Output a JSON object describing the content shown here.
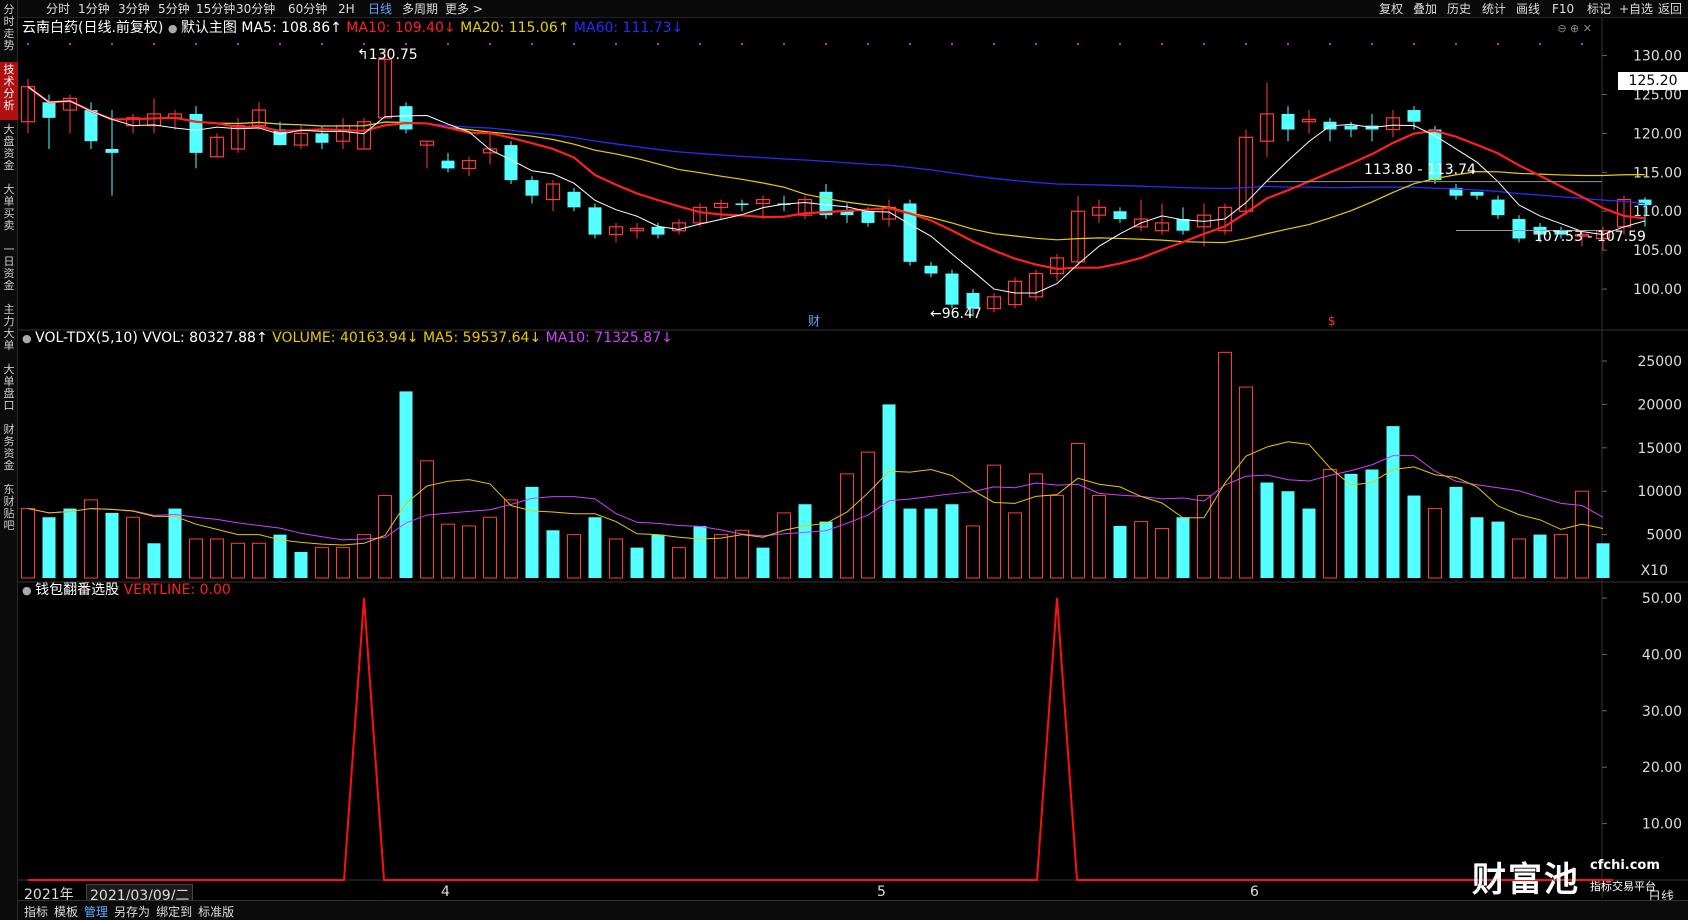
{
  "left_nav": [
    "分时走势",
    "技术分析",
    "大盘资金",
    "大单买卖",
    "一日资金",
    "主力大单",
    "大单盘口",
    "财务资金",
    "东财贴吧"
  ],
  "left_nav_active": 1,
  "period_tabs": [
    "分时",
    "1分钟",
    "3分钟",
    "5分钟",
    "15分钟",
    "30分钟",
    "60分钟",
    "2H",
    "日线",
    "多周期",
    "更多 >"
  ],
  "period_active": "日线",
  "right_tools": [
    "复权",
    "叠加",
    "历史",
    "统计",
    "画线",
    "F10",
    "标记",
    "+自选",
    "返回"
  ],
  "main_header": {
    "title": "云南白药(日线.前复权)",
    "template": "默认主图",
    "ma5": "MA5: 108.86↑",
    "ma10": "MA10: 109.40↓",
    "ma20": "MA20: 115.06↑",
    "ma60": "MA60: 111.73↓"
  },
  "vol_header": {
    "name": "VOL-TDX(5,10)",
    "vvol": "VVOL: 80327.88↑",
    "volume": "VOLUME: 40163.94↓",
    "ma5": "MA5: 59537.64↓",
    "ma10": "MA10: 71325.87↓"
  },
  "ind_header": {
    "name": "钱包翻番选股",
    "vertline": "VERTLINE: 0.00"
  },
  "annotations": {
    "high": "130.75",
    "low": "96.47",
    "range1": "113.80 - 113.74",
    "range2": "107.53 - 107.59",
    "price_tag": "125.20",
    "fin_mark": "财",
    "dollar_mark": "$"
  },
  "price_axis": [
    "130.00",
    "125.00",
    "120.00",
    "115.00",
    "110.00",
    "105.00",
    "100.00"
  ],
  "vol_axis": [
    "25000",
    "20000",
    "15000",
    "10000",
    "5000"
  ],
  "vol_unit": "X10",
  "ind_axis": [
    "50.00",
    "40.00",
    "30.00",
    "20.00",
    "10.00"
  ],
  "x_axis": {
    "year": "2021年",
    "date": "2021/03/09/二",
    "months": [
      "4",
      "5",
      "6"
    ]
  },
  "bottom_tabs": [
    "指标",
    "模板",
    "管理",
    "另存为",
    "绑定到",
    "标准版"
  ],
  "bottom_active": "管理",
  "watermark": {
    "brand": "财富池",
    "url": "cfchi.com",
    "slogan": "指标交易平台"
  },
  "corner": {
    "plus": "+",
    "minus": "-",
    "label": "日线"
  },
  "colors": {
    "up": "#ff3b3b",
    "down": "#54ffff",
    "ma5": "#ffffff",
    "ma10": "#ff2020",
    "ma20": "#e8d000",
    "ma60": "#2a2aff",
    "vma5": "#e8c800",
    "vma10": "#d040ff",
    "ind": "#ff1010"
  },
  "chart_data": {
    "type": "candlestick",
    "price_ylim": [
      95,
      132
    ],
    "candles": [
      {
        "o": 121.5,
        "h": 127.0,
        "l": 120.0,
        "c": 126.0
      },
      {
        "o": 124.0,
        "h": 125.0,
        "l": 118.0,
        "c": 122.0
      },
      {
        "o": 123.0,
        "h": 125.0,
        "l": 120.0,
        "c": 124.5
      },
      {
        "o": 123.0,
        "h": 124.0,
        "l": 118.0,
        "c": 119.0
      },
      {
        "o": 118.0,
        "h": 123.0,
        "l": 112.0,
        "c": 117.5
      },
      {
        "o": 121.0,
        "h": 122.5,
        "l": 120.0,
        "c": 122.0
      },
      {
        "o": 121.0,
        "h": 124.5,
        "l": 120.0,
        "c": 122.5
      },
      {
        "o": 122.0,
        "h": 123.0,
        "l": 120.5,
        "c": 122.5
      },
      {
        "o": 122.5,
        "h": 123.5,
        "l": 115.5,
        "c": 117.5
      },
      {
        "o": 117.0,
        "h": 120.0,
        "l": 117.0,
        "c": 119.5
      },
      {
        "o": 118.0,
        "h": 122.0,
        "l": 117.5,
        "c": 121.0
      },
      {
        "o": 121.0,
        "h": 124.0,
        "l": 120.5,
        "c": 123.0
      },
      {
        "o": 120.5,
        "h": 121.5,
        "l": 118.5,
        "c": 118.5
      },
      {
        "o": 118.5,
        "h": 121.0,
        "l": 118.0,
        "c": 120.0
      },
      {
        "o": 120.0,
        "h": 121.0,
        "l": 118.0,
        "c": 118.8
      },
      {
        "o": 119.0,
        "h": 122.0,
        "l": 118.0,
        "c": 121.0
      },
      {
        "o": 118.0,
        "h": 122.0,
        "l": 118.0,
        "c": 121.5
      },
      {
        "o": 122.0,
        "h": 131.0,
        "l": 122.0,
        "c": 129.5
      },
      {
        "o": 123.5,
        "h": 124.0,
        "l": 120.0,
        "c": 120.5
      },
      {
        "o": 118.5,
        "h": 119.0,
        "l": 115.5,
        "c": 119.0
      },
      {
        "o": 116.5,
        "h": 117.5,
        "l": 115.0,
        "c": 115.5
      },
      {
        "o": 115.5,
        "h": 117.0,
        "l": 114.5,
        "c": 116.5
      },
      {
        "o": 117.5,
        "h": 120.0,
        "l": 116.0,
        "c": 118.0
      },
      {
        "o": 118.5,
        "h": 119.0,
        "l": 113.5,
        "c": 114.0
      },
      {
        "o": 114.0,
        "h": 114.5,
        "l": 111.0,
        "c": 112.0
      },
      {
        "o": 111.5,
        "h": 114.0,
        "l": 110.0,
        "c": 113.5
      },
      {
        "o": 112.5,
        "h": 113.0,
        "l": 110.0,
        "c": 110.5
      },
      {
        "o": 110.5,
        "h": 111.0,
        "l": 106.5,
        "c": 107.0
      },
      {
        "o": 107.0,
        "h": 108.5,
        "l": 106.0,
        "c": 108.0
      },
      {
        "o": 107.5,
        "h": 108.5,
        "l": 106.5,
        "c": 107.8
      },
      {
        "o": 108.0,
        "h": 108.5,
        "l": 106.5,
        "c": 107.0
      },
      {
        "o": 107.5,
        "h": 109.0,
        "l": 107.0,
        "c": 108.5
      },
      {
        "o": 108.5,
        "h": 111.0,
        "l": 108.0,
        "c": 110.5
      },
      {
        "o": 110.5,
        "h": 111.5,
        "l": 109.0,
        "c": 111.0
      },
      {
        "o": 111.0,
        "h": 111.5,
        "l": 110.0,
        "c": 110.8
      },
      {
        "o": 111.0,
        "h": 112.0,
        "l": 109.0,
        "c": 111.5
      },
      {
        "o": 111.0,
        "h": 112.0,
        "l": 110.0,
        "c": 110.8
      },
      {
        "o": 109.5,
        "h": 112.0,
        "l": 109.0,
        "c": 111.5
      },
      {
        "o": 112.5,
        "h": 113.5,
        "l": 109.0,
        "c": 109.5
      },
      {
        "o": 110.0,
        "h": 111.0,
        "l": 108.5,
        "c": 109.5
      },
      {
        "o": 110.0,
        "h": 110.5,
        "l": 108.0,
        "c": 108.5
      },
      {
        "o": 109.0,
        "h": 111.5,
        "l": 108.0,
        "c": 110.5
      },
      {
        "o": 111.0,
        "h": 111.5,
        "l": 103.0,
        "c": 103.5
      },
      {
        "o": 103.0,
        "h": 103.5,
        "l": 101.5,
        "c": 102.0
      },
      {
        "o": 102.0,
        "h": 102.5,
        "l": 97.5,
        "c": 98.0
      },
      {
        "o": 99.5,
        "h": 100.0,
        "l": 96.5,
        "c": 97.5
      },
      {
        "o": 97.5,
        "h": 99.5,
        "l": 97.0,
        "c": 99.0
      },
      {
        "o": 98.0,
        "h": 101.5,
        "l": 97.5,
        "c": 101.0
      },
      {
        "o": 99.0,
        "h": 102.5,
        "l": 98.5,
        "c": 102.0
      },
      {
        "o": 102.0,
        "h": 104.5,
        "l": 101.0,
        "c": 104.0
      },
      {
        "o": 103.5,
        "h": 112.0,
        "l": 103.0,
        "c": 110.0
      },
      {
        "o": 109.5,
        "h": 111.5,
        "l": 108.5,
        "c": 110.5
      },
      {
        "o": 110.0,
        "h": 110.5,
        "l": 108.5,
        "c": 109.0
      },
      {
        "o": 108.0,
        "h": 111.5,
        "l": 107.5,
        "c": 109.0
      },
      {
        "o": 107.5,
        "h": 111.0,
        "l": 107.0,
        "c": 108.5
      },
      {
        "o": 109.0,
        "h": 110.5,
        "l": 107.0,
        "c": 107.5
      },
      {
        "o": 108.0,
        "h": 111.0,
        "l": 105.5,
        "c": 109.5
      },
      {
        "o": 107.5,
        "h": 111.0,
        "l": 107.0,
        "c": 110.5
      },
      {
        "o": 110.0,
        "h": 120.5,
        "l": 109.5,
        "c": 119.5
      },
      {
        "o": 119.0,
        "h": 126.5,
        "l": 117.0,
        "c": 122.5
      },
      {
        "o": 122.5,
        "h": 123.5,
        "l": 119.0,
        "c": 120.5
      },
      {
        "o": 121.5,
        "h": 123.0,
        "l": 120.0,
        "c": 121.8
      },
      {
        "o": 121.5,
        "h": 122.0,
        "l": 119.0,
        "c": 120.5
      },
      {
        "o": 121.0,
        "h": 121.5,
        "l": 119.5,
        "c": 120.5
      },
      {
        "o": 121.0,
        "h": 122.5,
        "l": 119.0,
        "c": 120.5
      },
      {
        "o": 120.5,
        "h": 123.0,
        "l": 119.5,
        "c": 122.0
      },
      {
        "o": 123.0,
        "h": 123.5,
        "l": 120.5,
        "c": 121.5
      },
      {
        "o": 120.5,
        "h": 121.0,
        "l": 113.5,
        "c": 114.0
      },
      {
        "o": 113.0,
        "h": 113.5,
        "l": 111.5,
        "c": 112.0
      },
      {
        "o": 112.5,
        "h": 112.5,
        "l": 111.5,
        "c": 112.0
      },
      {
        "o": 111.5,
        "h": 112.0,
        "l": 109.0,
        "c": 109.5
      },
      {
        "o": 109.0,
        "h": 109.5,
        "l": 106.0,
        "c": 106.5
      },
      {
        "o": 108.0,
        "h": 108.5,
        "l": 106.0,
        "c": 107.0
      },
      {
        "o": 107.5,
        "h": 108.0,
        "l": 106.5,
        "c": 107.0
      },
      {
        "o": 107.0,
        "h": 107.5,
        "l": 105.5,
        "c": 107.0
      },
      {
        "o": 106.5,
        "h": 108.0,
        "l": 105.0,
        "c": 107.5
      },
      {
        "o": 108.0,
        "h": 112.0,
        "l": 107.0,
        "c": 111.5
      },
      {
        "o": 111.5,
        "h": 111.8,
        "l": 108.0,
        "c": 110.8
      }
    ],
    "volume_ylim": [
      0,
      26500
    ],
    "volume": [
      8000,
      7000,
      8000,
      9000,
      7500,
      7000,
      4000,
      8000,
      4500,
      4500,
      4000,
      4000,
      5000,
      3000,
      3500,
      3500,
      5000,
      9500,
      21500,
      13500,
      6200,
      6000,
      7000,
      9000,
      10500,
      5500,
      5000,
      7000,
      4500,
      3500,
      5000,
      3500,
      6000,
      5000,
      5500,
      3500,
      7500,
      8500,
      6500,
      12000,
      14500,
      20000,
      8000,
      8000,
      8500,
      6000,
      13000,
      7500,
      12000,
      9500,
      15500,
      9500,
      6000,
      6500,
      5700,
      7000,
      9500,
      26000,
      22000,
      11000,
      10000,
      8000,
      12500,
      12000,
      12500,
      17500,
      9500,
      8000,
      10500,
      7000,
      6500,
      4500,
      5000,
      5000,
      10000,
      4000
    ],
    "vol_up": [
      1,
      0,
      0,
      1,
      0,
      1,
      0,
      0,
      1,
      1,
      1,
      1,
      0,
      0,
      1,
      1,
      1,
      1,
      0,
      1,
      1,
      1,
      1,
      1,
      0,
      0,
      1,
      0,
      1,
      0,
      0,
      1,
      0,
      1,
      1,
      0,
      1,
      0,
      0,
      1,
      1,
      0,
      0,
      0,
      0,
      1,
      1,
      1,
      1,
      1,
      1,
      1,
      0,
      1,
      1,
      0,
      1,
      1,
      1,
      0,
      0,
      0,
      1,
      0,
      0,
      0,
      0,
      1,
      0,
      0,
      0,
      1,
      0,
      1,
      1,
      0
    ],
    "ind_ylim": [
      0,
      50
    ],
    "ind_spikes": [
      16,
      49
    ],
    "ind_peak": 50
  }
}
